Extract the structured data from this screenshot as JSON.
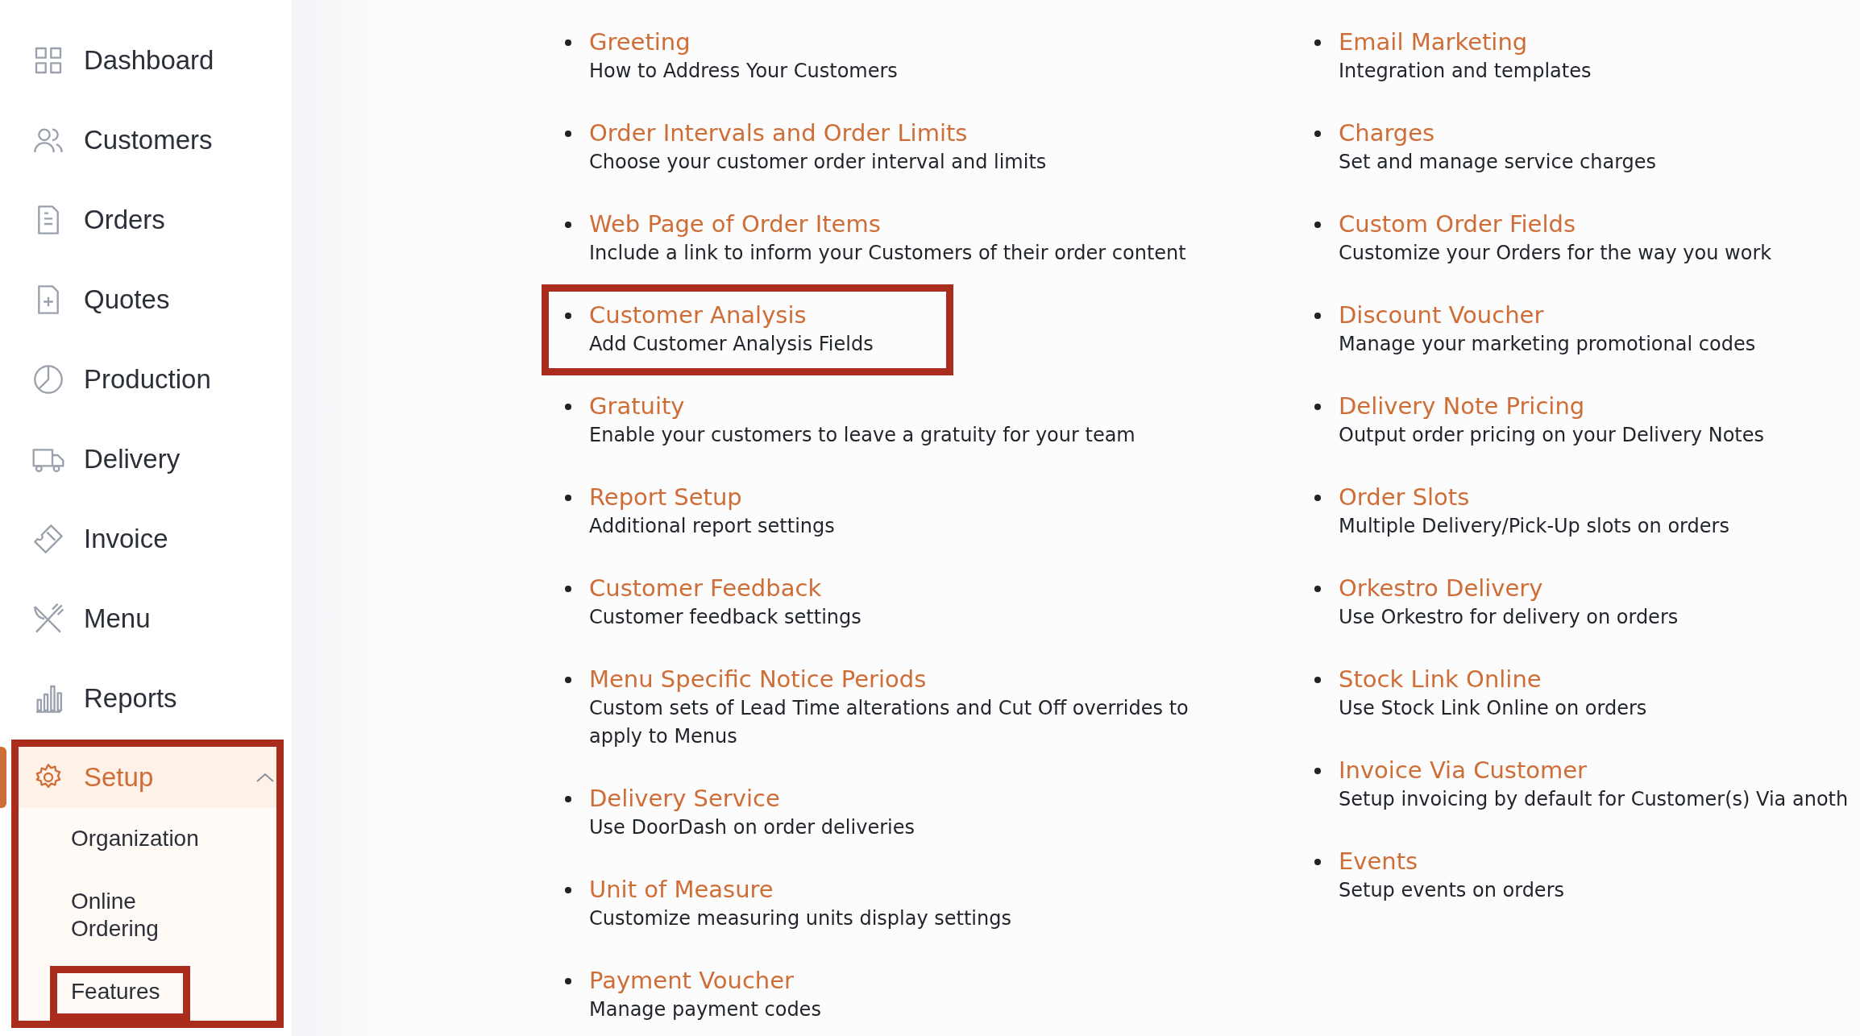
{
  "sidebar": {
    "items": [
      {
        "label": "Dashboard",
        "kind": "grid",
        "selected": false
      },
      {
        "label": "Customers",
        "kind": "people",
        "selected": false
      },
      {
        "label": "Orders",
        "kind": "document",
        "selected": false
      },
      {
        "label": "Quotes",
        "kind": "document-plus",
        "selected": false
      },
      {
        "label": "Production",
        "kind": "pie",
        "selected": false
      },
      {
        "label": "Delivery",
        "kind": "truck",
        "selected": false
      },
      {
        "label": "Invoice",
        "kind": "ticket",
        "selected": false
      },
      {
        "label": "Menu",
        "kind": "cutlery",
        "selected": false
      },
      {
        "label": "Reports",
        "kind": "bars",
        "selected": false
      },
      {
        "label": "Setup",
        "kind": "gear",
        "selected": true,
        "expanded": true,
        "highlighted": true,
        "children": [
          {
            "label": "Organization",
            "highlighted": false
          },
          {
            "label": "Online Ordering",
            "highlighted": false
          },
          {
            "label": "Features",
            "highlighted": true
          }
        ]
      }
    ]
  },
  "features": {
    "columns": [
      [
        {
          "title": "Greeting",
          "description": "How to Address Your Customers",
          "highlighted": false
        },
        {
          "title": "Order Intervals and Order Limits",
          "description": "Choose your customer order interval and limits",
          "highlighted": false
        },
        {
          "title": "Web Page of Order Items",
          "description": "Include a link to inform your Customers of their order content",
          "highlighted": false
        },
        {
          "title": "Customer Analysis",
          "description": "Add Customer Analysis Fields",
          "highlighted": true
        },
        {
          "title": "Gratuity",
          "description": "Enable your customers to leave a gratuity for your team",
          "highlighted": false
        },
        {
          "title": "Report Setup",
          "description": "Additional report settings",
          "highlighted": false
        },
        {
          "title": "Customer Feedback",
          "description": "Customer feedback settings",
          "highlighted": false
        },
        {
          "title": "Menu Specific Notice Periods",
          "description": "Custom sets of Lead Time alterations and Cut Off overrides to apply to Menus",
          "highlighted": false
        },
        {
          "title": "Delivery Service",
          "description": "Use DoorDash on order deliveries",
          "highlighted": false
        },
        {
          "title": "Unit of Measure",
          "description": "Customize measuring units display settings",
          "highlighted": false
        },
        {
          "title": "Payment Voucher",
          "description": "Manage payment codes",
          "highlighted": false
        }
      ],
      [
        {
          "title": "Email Marketing",
          "description": "Integration and templates",
          "highlighted": false
        },
        {
          "title": "Charges",
          "description": "Set and manage service charges",
          "highlighted": false
        },
        {
          "title": "Custom Order Fields",
          "description": "Customize your Orders for the way you work",
          "highlighted": false
        },
        {
          "title": "Discount Voucher",
          "description": "Manage your marketing promotional codes",
          "highlighted": false
        },
        {
          "title": "Delivery Note Pricing",
          "description": "Output order pricing on your Delivery Notes",
          "highlighted": false
        },
        {
          "title": "Order Slots",
          "description": "Multiple Delivery/Pick-Up slots on orders",
          "highlighted": false
        },
        {
          "title": "Orkestro Delivery",
          "description": "Use Orkestro for delivery on orders",
          "highlighted": false
        },
        {
          "title": "Stock Link Online",
          "description": "Use Stock Link Online on orders",
          "highlighted": false
        },
        {
          "title": "Invoice Via Customer",
          "description": "Setup invoicing by default for Customer(s) Via anoth",
          "highlighted": false
        },
        {
          "title": "Events",
          "description": "Setup events on orders",
          "highlighted": false
        }
      ]
    ]
  }
}
